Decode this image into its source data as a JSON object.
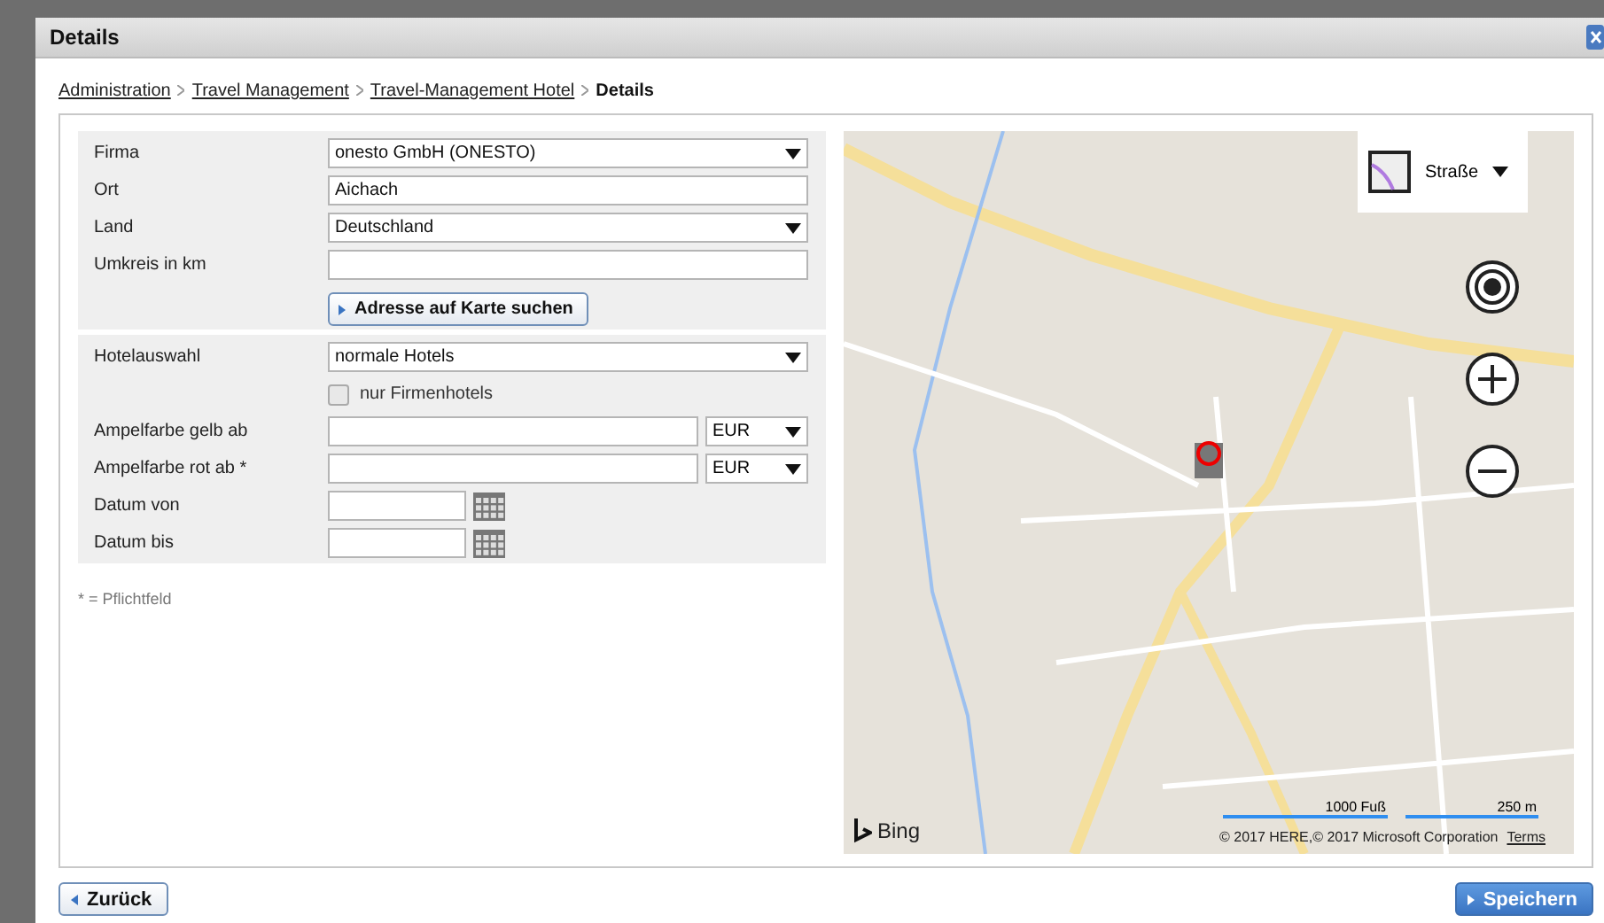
{
  "window": {
    "title": "Details"
  },
  "breadcrumb": [
    {
      "label": "Administration",
      "kind": "link"
    },
    {
      "label": "Travel Management",
      "kind": "link"
    },
    {
      "label": "Travel-Management Hotel",
      "kind": "link"
    },
    {
      "label": "Details",
      "kind": "current"
    }
  ],
  "sections": [
    {
      "rows": [
        {
          "label": "Firma",
          "kind": "select",
          "value": "onesto GmbH (ONESTO)"
        },
        {
          "label": "Ort",
          "kind": "text",
          "value": "Aichach"
        },
        {
          "label": "Land",
          "kind": "select",
          "value": "Deutschland"
        },
        {
          "label": "Umkreis in km",
          "kind": "text"
        },
        {
          "kind": "button",
          "text": "Adresse auf Karte suchen"
        }
      ]
    },
    {
      "rows": [
        {
          "label": "Hotelauswahl",
          "kind": "select",
          "value": "normale Hotels"
        },
        {
          "kind": "checkbox",
          "text": "nur Firmenhotels",
          "checked": false
        },
        {
          "label": "Ampelfarbe gelb ab",
          "kind": "amount",
          "currency": "EUR"
        },
        {
          "label": "Ampelfarbe rot ab *",
          "kind": "amount",
          "currency": "EUR"
        },
        {
          "label": "Datum von",
          "kind": "date"
        },
        {
          "label": "Datum bis",
          "kind": "date"
        }
      ]
    }
  ],
  "footnote": "* = Pflichtfeld",
  "map": {
    "style": "Straße",
    "logo": "Bing",
    "scale": [
      "1000 Fuß",
      "250 m"
    ],
    "copyright": "© 2017 HERE,© 2017 Microsoft Corporation",
    "terms": "Terms"
  },
  "buttons": [
    {
      "label": "Zurück",
      "kind": "back"
    },
    {
      "label": "Speichern",
      "kind": "primary"
    }
  ]
}
